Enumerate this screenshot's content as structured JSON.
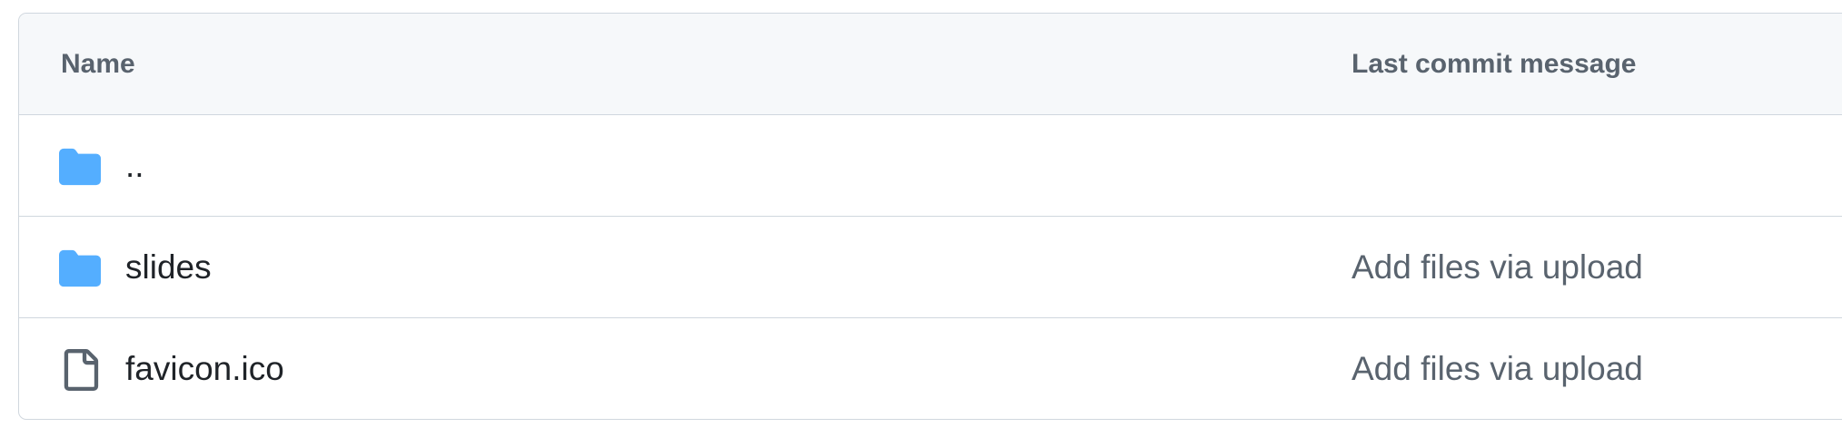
{
  "table": {
    "columns": {
      "name": "Name",
      "last_commit_message": "Last commit message"
    },
    "rows": [
      {
        "type": "directory",
        "icon": "folder-icon",
        "name": "..",
        "message": ""
      },
      {
        "type": "directory",
        "icon": "folder-icon",
        "name": "slides",
        "message": "Add files via upload"
      },
      {
        "type": "file",
        "icon": "file-icon",
        "name": "favicon.ico",
        "message": "Add files via upload"
      }
    ]
  },
  "colors": {
    "folder": "#54aeff",
    "file_icon": "#59636e",
    "border": "#d0d7de",
    "header_bg": "#f6f8fa",
    "header_text": "#59636e",
    "message_text": "#59636e",
    "name_text": "#1f2328"
  }
}
